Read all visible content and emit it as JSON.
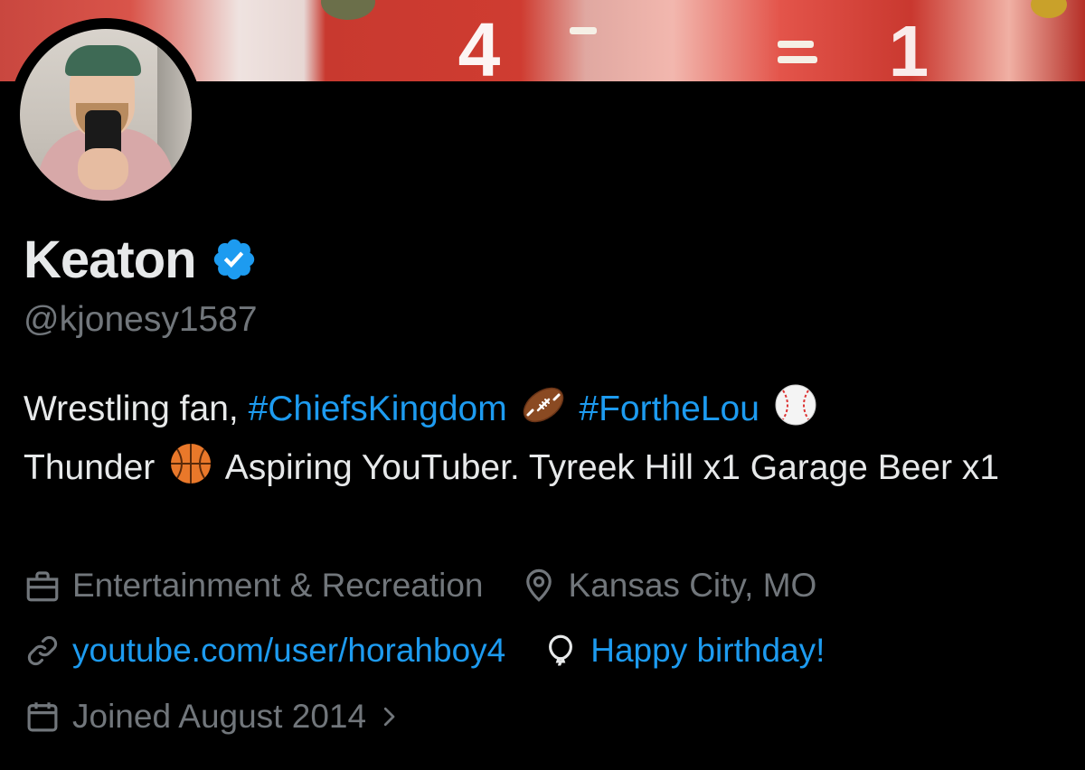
{
  "profile": {
    "name": "Keaton",
    "handle": "@kjonesy1587",
    "verified_icon": "verified-badge-icon",
    "banner_numbers": [
      "4",
      "1"
    ]
  },
  "bio": {
    "part1": "Wrestling fan, ",
    "tag1": "#ChiefsKingdom",
    "tag2": "#FortheLou",
    "part2": "Thunder",
    "part3": "Aspiring YouTuber. Tyreek Hill x1 Garage Beer x1",
    "emojis": [
      "football-emoji",
      "baseball-emoji",
      "basketball-emoji"
    ]
  },
  "meta": {
    "category": "Entertainment & Recreation",
    "location": "Kansas City, MO",
    "website": "youtube.com/user/horahboy4",
    "birthday": "Happy birthday!",
    "joined": "Joined August 2014",
    "icons": [
      "briefcase-icon",
      "location-pin-icon",
      "link-icon",
      "balloon-icon",
      "calendar-icon",
      "chevron-right-icon"
    ]
  },
  "colors": {
    "background": "#000000",
    "text": "#e7e9ea",
    "muted": "#71767b",
    "accent": "#1d9bf0"
  }
}
